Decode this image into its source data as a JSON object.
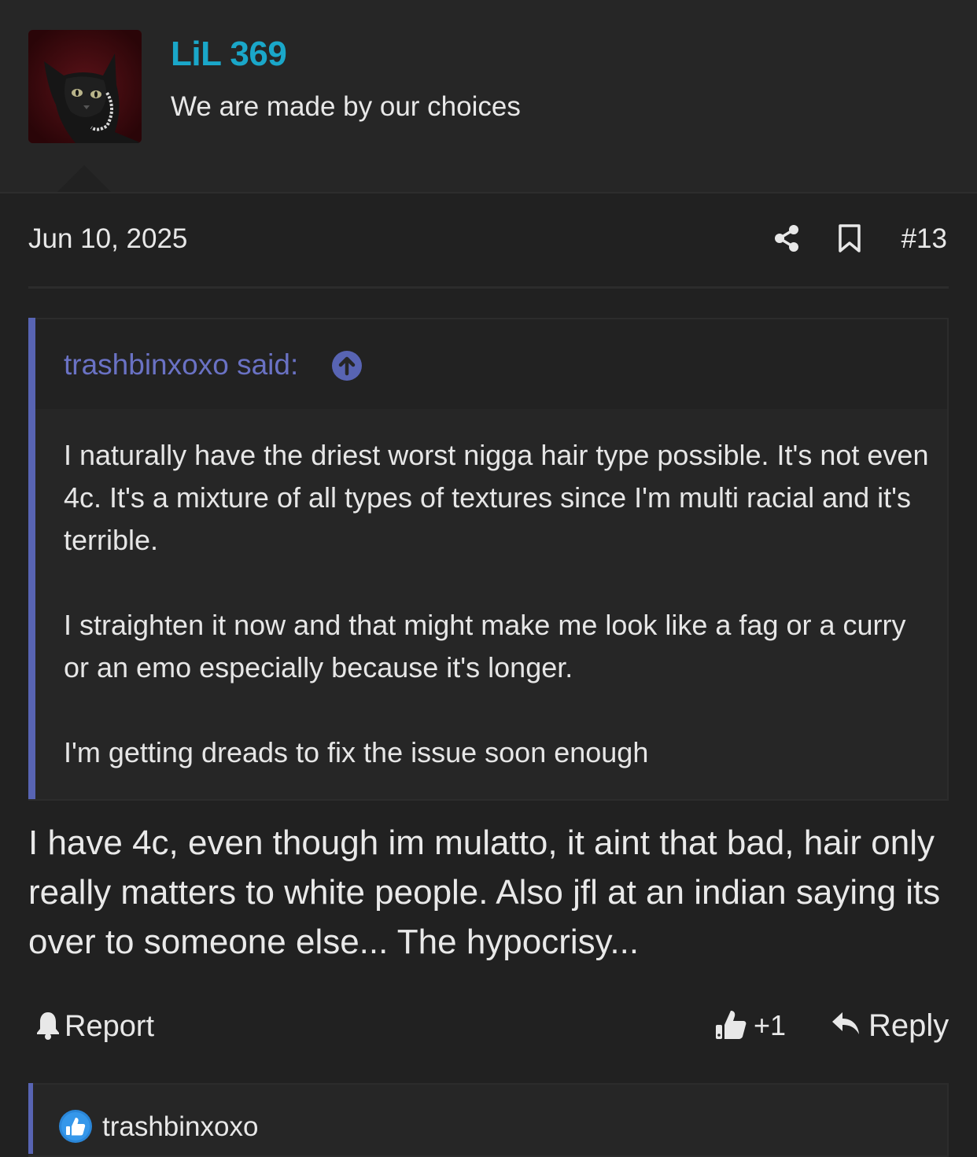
{
  "user": {
    "name": "LiL 369",
    "title": "We are made by our choices"
  },
  "post": {
    "date": "Jun 10, 2025",
    "number": "#13",
    "quote": {
      "author": "trashbinxoxo said:",
      "paragraphs": [
        "I naturally have the driest worst nigga hair type possible. It's not even 4c. It's a mixture of all types of textures since I'm multi racial and it's terrible.",
        "I straighten it now and that might make me look like a fag or a curry or an emo especially because it's longer.",
        "I'm getting dreads to fix the issue soon enough"
      ]
    },
    "body": "I have 4c, even though im mulatto, it aint that bad, hair only really matters to white people. Also jfl at an indian saying its over to someone else... The hypocrisy..."
  },
  "actions": {
    "report_label": "Report",
    "like_count": "+1",
    "reply_label": "Reply"
  },
  "reactions": {
    "user": "trashbinxoxo"
  },
  "colors": {
    "background": "#212121",
    "header": "#262626",
    "username": "#1aa7c9",
    "quote_accent": "#5864b3",
    "quote_author": "#6a72c4"
  },
  "icons": [
    "share-icon",
    "bookmark-icon",
    "arrow-up-circle-icon",
    "bell-icon",
    "thumbs-up-icon",
    "reply-arrow-icon",
    "like-badge-icon"
  ]
}
